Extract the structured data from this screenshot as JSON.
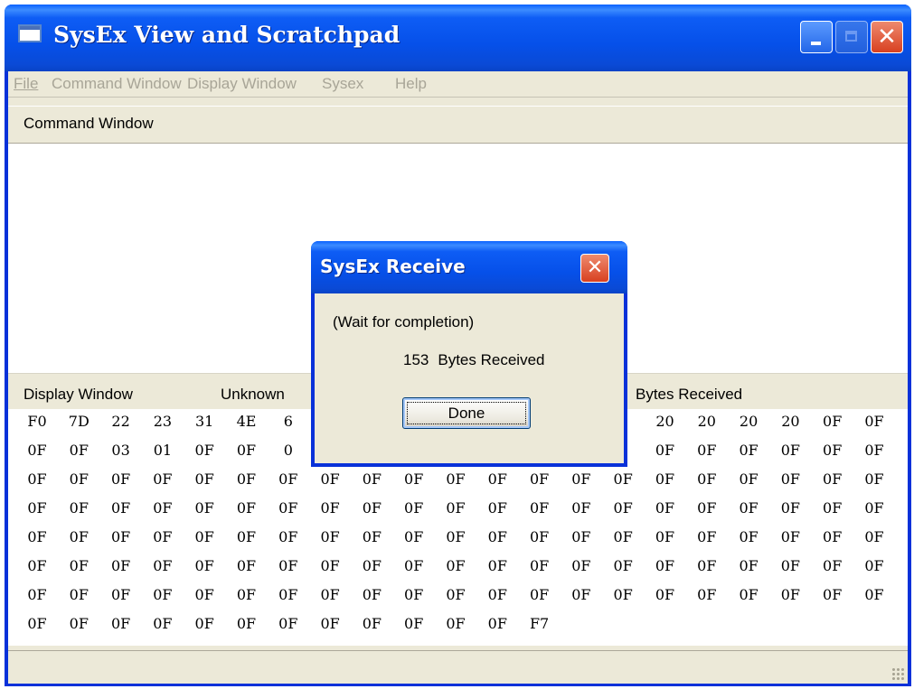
{
  "window": {
    "title": "SysEx View and Scratchpad"
  },
  "menu": [
    "File",
    "Command Window",
    "Display Window",
    "Sysex",
    "Help"
  ],
  "command_window": {
    "label": "Command Window"
  },
  "display_window": {
    "label": "Display Window",
    "status": "Unknown",
    "bytes_label": "Bytes Received"
  },
  "hex_rows": [
    [
      "F0",
      "7D",
      "22",
      "23",
      "31",
      "4E",
      "6",
      "",
      "",
      "",
      "",
      "",
      "",
      "",
      "0",
      "20",
      "20",
      "20",
      "20",
      "0F",
      "0F"
    ],
    [
      "0F",
      "0F",
      "03",
      "01",
      "0F",
      "0F",
      "0",
      "",
      "",
      "",
      "",
      "",
      "",
      "",
      "",
      "0F",
      "0F",
      "0F",
      "0F",
      "0F",
      "0F"
    ],
    [
      "0F",
      "0F",
      "0F",
      "0F",
      "0F",
      "0F",
      "0F",
      "0F",
      "0F",
      "0F",
      "0F",
      "0F",
      "0F",
      "0F",
      "0F",
      "0F",
      "0F",
      "0F",
      "0F",
      "0F",
      "0F"
    ],
    [
      "0F",
      "0F",
      "0F",
      "0F",
      "0F",
      "0F",
      "0F",
      "0F",
      "0F",
      "0F",
      "0F",
      "0F",
      "0F",
      "0F",
      "0F",
      "0F",
      "0F",
      "0F",
      "0F",
      "0F",
      "0F"
    ],
    [
      "0F",
      "0F",
      "0F",
      "0F",
      "0F",
      "0F",
      "0F",
      "0F",
      "0F",
      "0F",
      "0F",
      "0F",
      "0F",
      "0F",
      "0F",
      "0F",
      "0F",
      "0F",
      "0F",
      "0F",
      "0F"
    ],
    [
      "0F",
      "0F",
      "0F",
      "0F",
      "0F",
      "0F",
      "0F",
      "0F",
      "0F",
      "0F",
      "0F",
      "0F",
      "0F",
      "0F",
      "0F",
      "0F",
      "0F",
      "0F",
      "0F",
      "0F",
      "0F"
    ],
    [
      "0F",
      "0F",
      "0F",
      "0F",
      "0F",
      "0F",
      "0F",
      "0F",
      "0F",
      "0F",
      "0F",
      "0F",
      "0F",
      "0F",
      "0F",
      "0F",
      "0F",
      "0F",
      "0F",
      "0F",
      "0F"
    ],
    [
      "0F",
      "0F",
      "0F",
      "0F",
      "0F",
      "0F",
      "0F",
      "0F",
      "0F",
      "0F",
      "0F",
      "0F",
      "F7"
    ]
  ],
  "dialog": {
    "title": "SysEx Receive",
    "status": "(Wait for completion)",
    "count": "153",
    "count_label": "Bytes Received",
    "button": "Done"
  }
}
